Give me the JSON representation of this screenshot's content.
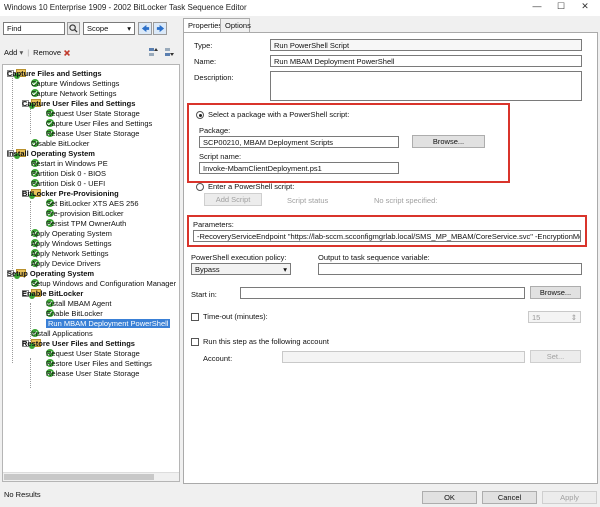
{
  "window": {
    "title": "Windows 10 Enterprise 1909 - 2002 BitLocker Task Sequence Editor",
    "minimize": "—",
    "maximize": "☐",
    "close": "✕"
  },
  "toolbar": {
    "find_value": "Find",
    "scope_value": "Scope",
    "add_label": "Add",
    "remove_label": "Remove"
  },
  "tree": {
    "rows": [
      {
        "label": "Capture Files and Settings",
        "kind": "group"
      },
      {
        "label": "Capture Windows Settings",
        "kind": "item"
      },
      {
        "label": "Capture Network Settings",
        "kind": "item"
      },
      {
        "label": "Capture User Files and Settings",
        "kind": "group"
      },
      {
        "label": "Request User State Storage",
        "kind": "item"
      },
      {
        "label": "Capture User Files and Settings",
        "kind": "item"
      },
      {
        "label": "Release User State Storage",
        "kind": "item"
      },
      {
        "label": "Disable BitLocker",
        "kind": "item"
      },
      {
        "label": "Install Operating System",
        "kind": "group"
      },
      {
        "label": "Restart in Windows PE",
        "kind": "item"
      },
      {
        "label": "Partition Disk 0 - BIOS",
        "kind": "item"
      },
      {
        "label": "Partition Disk 0 - UEFI",
        "kind": "item"
      },
      {
        "label": "BitLocker Pre-Provisioning",
        "kind": "group"
      },
      {
        "label": "Set BitLocker XTS AES 256",
        "kind": "item"
      },
      {
        "label": "Pre-provision BitLocker",
        "kind": "item"
      },
      {
        "label": "Persist TPM OwnerAuth",
        "kind": "item"
      },
      {
        "label": "Apply Operating System",
        "kind": "item"
      },
      {
        "label": "Apply Windows Settings",
        "kind": "item"
      },
      {
        "label": "Apply Network Settings",
        "kind": "item"
      },
      {
        "label": "Apply Device Drivers",
        "kind": "item"
      },
      {
        "label": "Setup Operating System",
        "kind": "group"
      },
      {
        "label": "Setup Windows and Configuration Manager",
        "kind": "item"
      },
      {
        "label": "Enable BitLocker",
        "kind": "group"
      },
      {
        "label": "Install MBAM Agent",
        "kind": "item"
      },
      {
        "label": "Enable BitLocker",
        "kind": "item"
      },
      {
        "label": "Run MBAM Deployment PowerShell",
        "kind": "item",
        "selected": true
      },
      {
        "label": "Install Applications",
        "kind": "item"
      },
      {
        "label": "Restore User Files and Settings",
        "kind": "group"
      },
      {
        "label": "Request User State Storage",
        "kind": "item"
      },
      {
        "label": "Restore User Files and Settings",
        "kind": "item"
      },
      {
        "label": "Release User State Storage",
        "kind": "item"
      }
    ]
  },
  "tabs": {
    "properties": "Properties",
    "options": "Options"
  },
  "props": {
    "type_label": "Type:",
    "type_value": "Run PowerShell Script",
    "name_label": "Name:",
    "name_value": "Run MBAM Deployment PowerShell",
    "description_label": "Description:",
    "description_value": "",
    "select_package_label": "Select a package with a PowerShell script:",
    "package_label": "Package:",
    "package_value": "SCP00210, MBAM Deployment Scripts",
    "browse_label": "Browse...",
    "script_name_label": "Script name:",
    "script_name_value": "Invoke-MbamClientDeployment.ps1",
    "enter_script_label": "Enter a PowerShell script:",
    "add_script_label": "Add Script",
    "script_status_label": "Script status",
    "no_script_label": "No script specified:",
    "parameters_label": "Parameters:",
    "parameters_value": "-RecoveryServiceEndpoint \"https://lab-sccm.scconfigmgrlab.local/SMS_MP_MBAM/CoreService.svc\" -EncryptionMethod \"XtsAes256\"",
    "execution_policy_label": "PowerShell execution policy:",
    "execution_policy_value": "Bypass",
    "output_variable_label": "Output to task sequence variable:",
    "output_variable_value": "",
    "start_in_label": "Start in:",
    "start_in_value": "",
    "timeout_label": "Time-out (minutes):",
    "timeout_value": "15",
    "run_as_label": "Run this step as the following account",
    "account_label": "Account:",
    "account_value": "",
    "set_label": "Set..."
  },
  "status": {
    "results": "No Results"
  },
  "footer": {
    "ok": "OK",
    "cancel": "Cancel",
    "apply": "Apply"
  },
  "colors": {
    "highlight": "#d9342b",
    "selection": "#3a80d6",
    "success": "#3ba535"
  }
}
